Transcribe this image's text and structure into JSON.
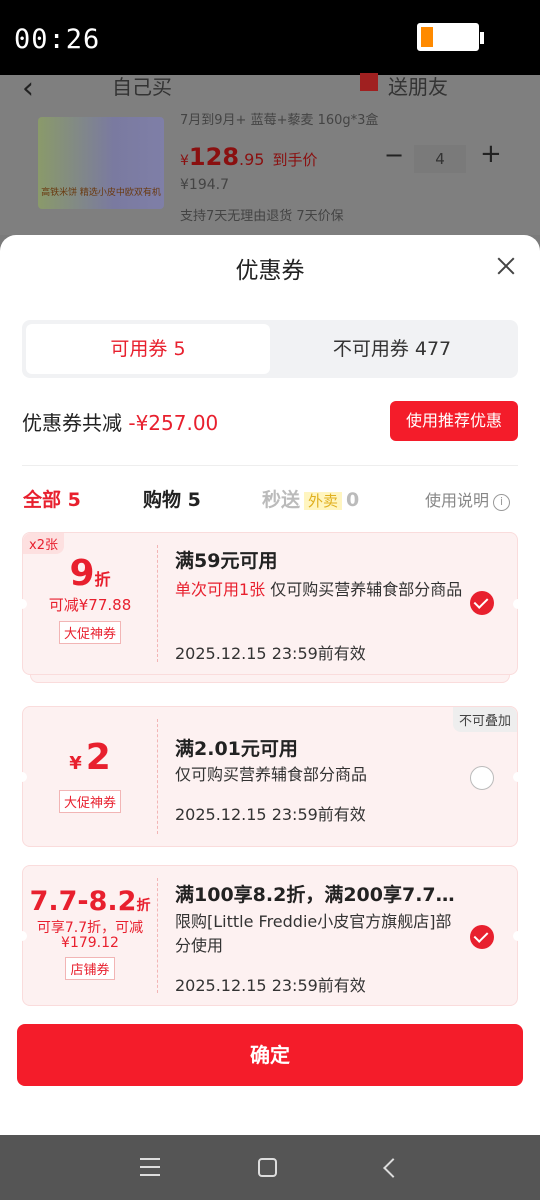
{
  "status": {
    "time": "00:26"
  },
  "background": {
    "tab_self": "自己买",
    "tab_gift": "送朋友",
    "spec": "7月到9月+ 蓝莓+藜麦 160g*3盒",
    "thumb_caption": "高铁米饼 精选小皮中欧双有机",
    "price_int": "128",
    "price_dec": ".95",
    "price_tag": "到手价",
    "price_symbol": "¥",
    "orig_price": "¥194.7",
    "promise": "支持7天无理由退货  7天价保",
    "minus": "−",
    "qty": "4",
    "plus": "+"
  },
  "sheet": {
    "title": "优惠券",
    "tabs": [
      {
        "label": "可用券 5"
      },
      {
        "label": "不可用券 477"
      }
    ],
    "total_label": "优惠券共减",
    "total_amount": "-¥257.00",
    "recommend_button": "使用推荐优惠",
    "filters": {
      "all": "全部 5",
      "shop": "购物 5",
      "fast_prefix": "秒送",
      "fast_waimai": "外卖",
      "fast_count": "0",
      "help": "使用说明",
      "help_icon": "i"
    },
    "coupons": [
      {
        "badge": "x2张",
        "big": "9",
        "unit": "折",
        "sub": "可减¥77.88",
        "kind": "大促神券",
        "title": "满59元可用",
        "highlight": "单次可用1张",
        "desc": "仅可购买营养辅食部分商品",
        "expiry": "2025.12.15 23:59前有效",
        "checked": true
      },
      {
        "notice": "不可叠加",
        "symbol": "¥",
        "big": "2",
        "kind": "大促神券",
        "title": "满2.01元可用",
        "desc": "仅可购买营养辅食部分商品",
        "expiry": "2025.12.15 23:59前有效",
        "checked": false
      },
      {
        "big": "7.7-8.2",
        "unit": "折",
        "sub": "可享7.7折，可减¥179.12",
        "kind": "店铺券",
        "title": "满100享8.2折，满200享7.7…",
        "desc": "限购[Little Freddie小皮官方旗舰店]部分使用",
        "expiry": "2025.12.15 23:59前有效",
        "checked": true
      }
    ],
    "confirm": "确定"
  },
  "colors": {
    "accent": "#e8202e",
    "button": "#f41c2a",
    "coupon_bg": "#fdf1f1"
  },
  "icons": [
    "close-icon",
    "check-icon",
    "info-icon",
    "menu-icon",
    "home-icon",
    "back-icon",
    "gift-icon"
  ]
}
